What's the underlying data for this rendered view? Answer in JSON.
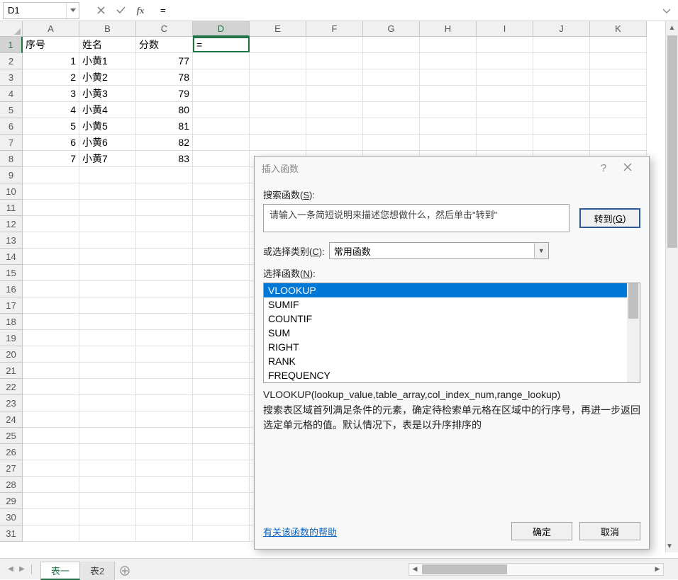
{
  "nameBox": "D1",
  "formulaInput": "=",
  "columns": [
    "A",
    "B",
    "C",
    "D",
    "E",
    "F",
    "G",
    "H",
    "I",
    "J",
    "K"
  ],
  "rowCount": 31,
  "activeCell": {
    "row": 1,
    "col": 4
  },
  "gridData": [
    [
      "序号",
      "姓名",
      "分数",
      "="
    ],
    [
      "1",
      "小黄1",
      "77"
    ],
    [
      "2",
      "小黄2",
      "78"
    ],
    [
      "3",
      "小黄3",
      "79"
    ],
    [
      "4",
      "小黄4",
      "80"
    ],
    [
      "5",
      "小黄5",
      "81"
    ],
    [
      "6",
      "小黄6",
      "82"
    ],
    [
      "7",
      "小黄7",
      "83"
    ]
  ],
  "numericCols": {
    "A_from_row": 2,
    "C_from_row": 2
  },
  "sheets": {
    "active": "表一",
    "others": [
      "表2"
    ]
  },
  "dialog": {
    "title": "插入函数",
    "searchLabelPrefix": "搜索函数(",
    "searchLabelKey": "S",
    "searchLabelSuffix": "):",
    "searchPlaceholder": "请输入一条简短说明来描述您想做什么，然后单击\"转到\"",
    "gotoPrefix": "转到(",
    "gotoKey": "G",
    "gotoSuffix": ")",
    "catLabelPrefix": "或选择类别(",
    "catLabelKey": "C",
    "catLabelSuffix": "):",
    "catValue": "常用函数",
    "funcLabelPrefix": "选择函数(",
    "funcLabelKey": "N",
    "funcLabelSuffix": "):",
    "functions": [
      "VLOOKUP",
      "SUMIF",
      "COUNTIF",
      "SUM",
      "RIGHT",
      "RANK",
      "FREQUENCY"
    ],
    "selectedFunction": "VLOOKUP",
    "syntax": "VLOOKUP(lookup_value,table_array,col_index_num,range_lookup)",
    "description": "搜索表区域首列满足条件的元素，确定待检索单元格在区域中的行序号，再进一步返回选定单元格的值。默认情况下，表是以升序排序的",
    "helpLink": "有关该函数的帮助",
    "okButton": "确定",
    "cancelButton": "取消"
  }
}
